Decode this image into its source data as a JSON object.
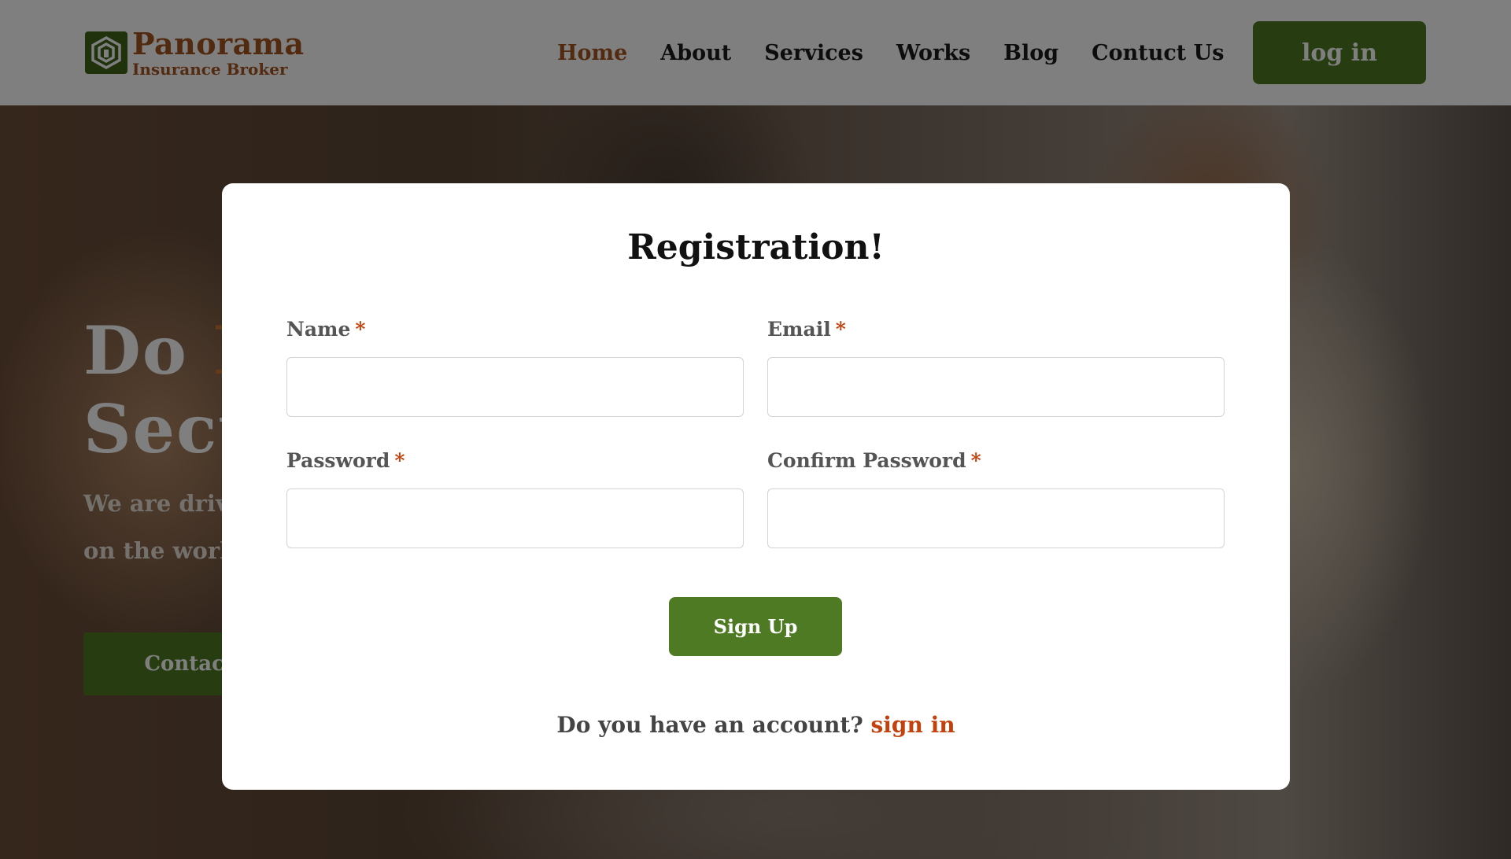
{
  "header": {
    "logo_name": "Panorama",
    "logo_sub": "Insurance Broker",
    "nav": [
      {
        "label": "Home",
        "active": true
      },
      {
        "label": "About",
        "active": false
      },
      {
        "label": "Services",
        "active": false
      },
      {
        "label": "Works",
        "active": false
      },
      {
        "label": "Blog",
        "active": false
      },
      {
        "label": "Contuct Us",
        "active": false
      }
    ],
    "login_label": "log in"
  },
  "hero": {
    "title_line1_a": "Do ",
    "title_line1_b": "I",
    "title_line2": "Secu",
    "subtitle_line1": "We are driv",
    "subtitle_line2": "on the worl",
    "cta_label": "Contact U"
  },
  "modal": {
    "title": "Registration!",
    "fields": [
      {
        "label": "Name",
        "required_mark": "*",
        "value": "",
        "placeholder": ""
      },
      {
        "label": "Email",
        "required_mark": "*",
        "value": "",
        "placeholder": ""
      },
      {
        "label": "Password",
        "required_mark": "*",
        "value": "",
        "placeholder": ""
      },
      {
        "label": "Confirm Password",
        "required_mark": "*",
        "value": "",
        "placeholder": ""
      }
    ],
    "signup_label": "Sign Up",
    "account_prompt": "Do you have an account? ",
    "signin_label": "sign in"
  },
  "colors": {
    "brand_green": "#4e7a23",
    "brand_brown": "#a4551f",
    "required_red": "#c2410c",
    "overlay": "rgba(0,0,0,0.5)"
  },
  "icons": {
    "logo": "hexagon-logo-icon"
  }
}
